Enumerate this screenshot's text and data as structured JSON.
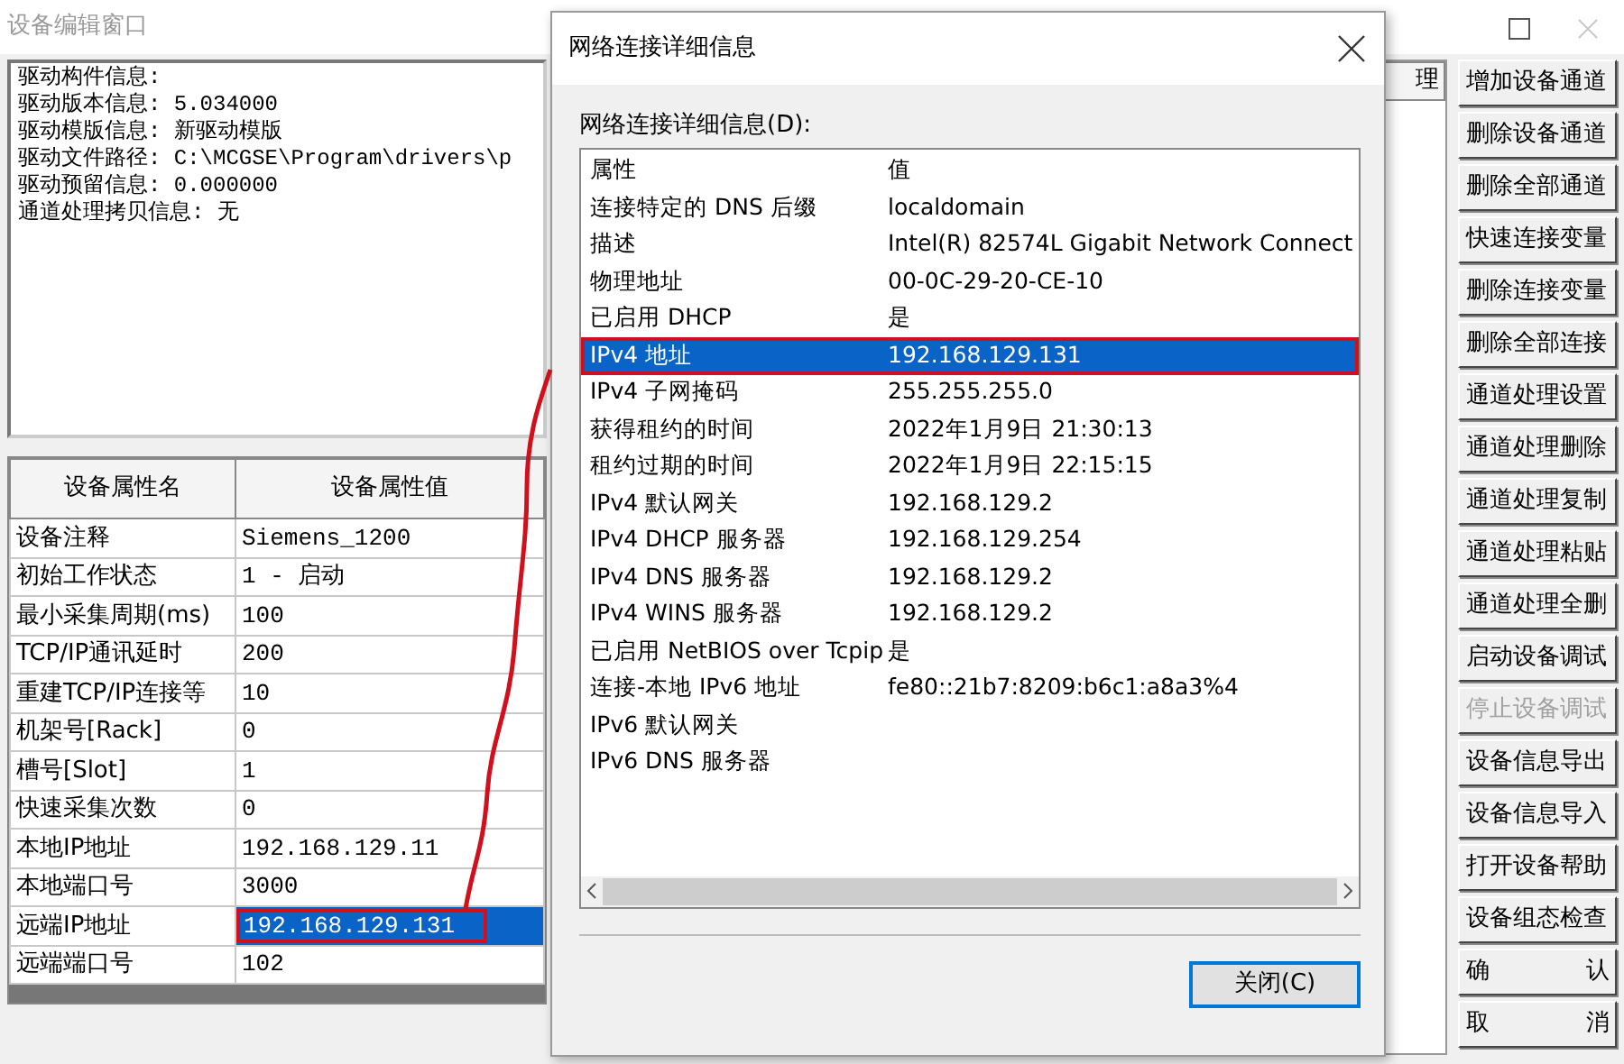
{
  "window": {
    "title": "设备编辑窗口"
  },
  "driver_info": [
    "驱动构件信息:",
    "驱动版本信息: 5.034000",
    "驱动模版信息: 新驱动模版",
    "驱动文件路径: C:\\MCGSE\\Program\\drivers\\p",
    "驱动预留信息: 0.000000",
    "通道处理拷贝信息: 无"
  ],
  "property_table": {
    "columns": [
      "设备属性名",
      "设备属性值"
    ],
    "rows": [
      {
        "name": "设备注释",
        "value": "Siemens_1200",
        "selected": false,
        "highlighted": false
      },
      {
        "name": "初始工作状态",
        "value": "1 - 启动",
        "selected": false,
        "highlighted": false
      },
      {
        "name": "最小采集周期(ms)",
        "value": "100",
        "selected": false,
        "highlighted": false
      },
      {
        "name": "TCP/IP通讯延时",
        "value": "200",
        "selected": false,
        "highlighted": false
      },
      {
        "name": "重建TCP/IP连接等",
        "value": "10",
        "selected": false,
        "highlighted": false
      },
      {
        "name": "机架号[Rack]",
        "value": "0",
        "selected": false,
        "highlighted": false
      },
      {
        "name": "槽号[Slot]",
        "value": "1",
        "selected": false,
        "highlighted": false
      },
      {
        "name": "快速采集次数",
        "value": "0",
        "selected": false,
        "highlighted": false
      },
      {
        "name": "本地IP地址",
        "value": "192.168.129.11",
        "selected": false,
        "highlighted": false
      },
      {
        "name": "本地端口号",
        "value": "3000",
        "selected": false,
        "highlighted": false
      },
      {
        "name": "远端IP地址",
        "value": "192.168.129.131",
        "selected": true,
        "highlighted": true
      },
      {
        "name": "远端端口号",
        "value": "102",
        "selected": false,
        "highlighted": false
      }
    ]
  },
  "channel_table": {
    "column_header": "理"
  },
  "buttons": [
    {
      "label": "增加设备通道",
      "disabled": false
    },
    {
      "label": "删除设备通道",
      "disabled": false
    },
    {
      "label": "删除全部通道",
      "disabled": false
    },
    {
      "label": "快速连接变量",
      "disabled": false
    },
    {
      "label": "删除连接变量",
      "disabled": false
    },
    {
      "label": "删除全部连接",
      "disabled": false
    },
    {
      "label": "通道处理设置",
      "disabled": false
    },
    {
      "label": "通道处理删除",
      "disabled": false
    },
    {
      "label": "通道处理复制",
      "disabled": false
    },
    {
      "label": "通道处理粘贴",
      "disabled": false
    },
    {
      "label": "通道处理全删",
      "disabled": false
    },
    {
      "label": "启动设备调试",
      "disabled": false
    },
    {
      "label": "停止设备调试",
      "disabled": true
    },
    {
      "label": "设备信息导出",
      "disabled": false
    },
    {
      "label": "设备信息导入",
      "disabled": false
    },
    {
      "label": "打开设备帮助",
      "disabled": false
    },
    {
      "label": "设备组态检查",
      "disabled": false
    },
    {
      "label": "确 认",
      "disabled": false
    },
    {
      "label": "取 消",
      "disabled": false
    }
  ],
  "dialog": {
    "title": "网络连接详细信息",
    "list_label": "网络连接详细信息(D):",
    "columns": [
      "属性",
      "值"
    ],
    "rows": [
      {
        "property": "连接特定的 DNS 后缀",
        "value": "localdomain",
        "selected": false,
        "highlighted": false
      },
      {
        "property": "描述",
        "value": "Intel(R) 82574L Gigabit Network Connect",
        "selected": false,
        "highlighted": false
      },
      {
        "property": "物理地址",
        "value": "00-0C-29-20-CE-10",
        "selected": false,
        "highlighted": false
      },
      {
        "property": "已启用 DHCP",
        "value": "是",
        "selected": false,
        "highlighted": false
      },
      {
        "property": "IPv4 地址",
        "value": "192.168.129.131",
        "selected": true,
        "highlighted": true
      },
      {
        "property": "IPv4 子网掩码",
        "value": "255.255.255.0",
        "selected": false,
        "highlighted": false
      },
      {
        "property": "获得租约的时间",
        "value": "2022年1月9日 21:30:13",
        "selected": false,
        "highlighted": false
      },
      {
        "property": "租约过期的时间",
        "value": "2022年1月9日 22:15:15",
        "selected": false,
        "highlighted": false
      },
      {
        "property": "IPv4 默认网关",
        "value": "192.168.129.2",
        "selected": false,
        "highlighted": false
      },
      {
        "property": "IPv4 DHCP 服务器",
        "value": "192.168.129.254",
        "selected": false,
        "highlighted": false
      },
      {
        "property": "IPv4 DNS 服务器",
        "value": "192.168.129.2",
        "selected": false,
        "highlighted": false
      },
      {
        "property": "IPv4 WINS 服务器",
        "value": "192.168.129.2",
        "selected": false,
        "highlighted": false
      },
      {
        "property": "已启用 NetBIOS over Tcpip",
        "value": "是",
        "selected": false,
        "highlighted": false
      },
      {
        "property": "连接-本地 IPv6 地址",
        "value": "fe80::21b7:8209:b6c1:a8a3%4",
        "selected": false,
        "highlighted": false
      },
      {
        "property": "IPv6 默认网关",
        "selected": false,
        "highlighted": false
      },
      {
        "property": "IPv6 DNS 服务器",
        "selected": false,
        "highlighted": false
      }
    ],
    "close_button": "关闭(C)"
  }
}
